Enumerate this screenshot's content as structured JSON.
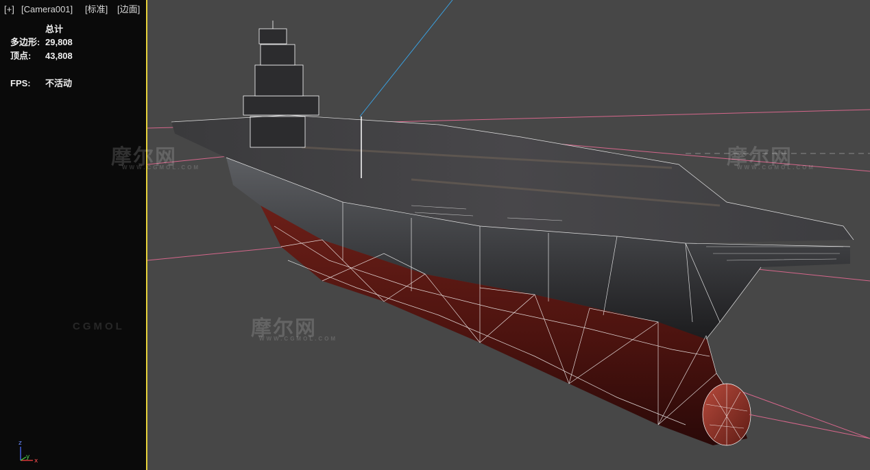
{
  "viewport": {
    "labels": {
      "plus": "[+]",
      "camera": "[Camera001]",
      "shading": "[标准]",
      "display": "[边面]"
    }
  },
  "stats": {
    "header": "总计",
    "polygons_label": "多边形:",
    "polygons_value": "29,808",
    "vertices_label": "顶点:",
    "vertices_value": "43,808",
    "fps_label": "FPS:",
    "fps_value": "不活动"
  },
  "watermarks": {
    "brand_cn": "摩尔网",
    "brand_url": "WWW.CGMOL.COM",
    "brand_en": "CGMOL"
  },
  "gizmo": {
    "z": "z",
    "y": "y",
    "x": "x"
  },
  "colors": {
    "background": "#474747",
    "panel": "#0a0a0a",
    "panel_border": "#e8d23a",
    "hull_red": "#5a1712",
    "deck_gray": "#3e3e40",
    "wire": "#ffffff",
    "grid_pink": "#d7678c",
    "camera_line": "#3aa0e0"
  }
}
